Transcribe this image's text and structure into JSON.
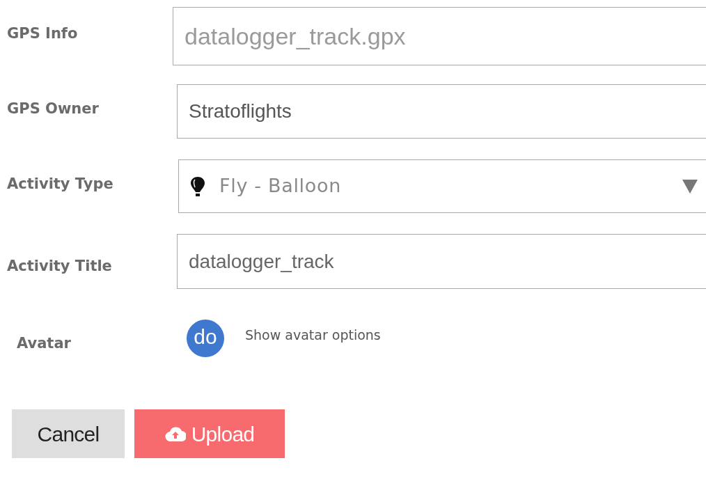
{
  "fields": [
    {
      "kind": "text",
      "label": "GPS Info",
      "value": "datalogger_track.gpx"
    },
    {
      "kind": "text",
      "label": "GPS Owner",
      "value": "Stratoflights"
    },
    {
      "kind": "select",
      "label": "Activity Type",
      "value": "Fly - Balloon"
    },
    {
      "kind": "text",
      "label": "Activity Title",
      "value": "datalogger_track"
    }
  ],
  "avatar": {
    "label": "Avatar",
    "initials": "do",
    "link": "Show avatar options"
  },
  "buttons": [
    {
      "kind": "cancel",
      "label": "Cancel"
    },
    {
      "kind": "upload",
      "label": "Upload"
    }
  ]
}
